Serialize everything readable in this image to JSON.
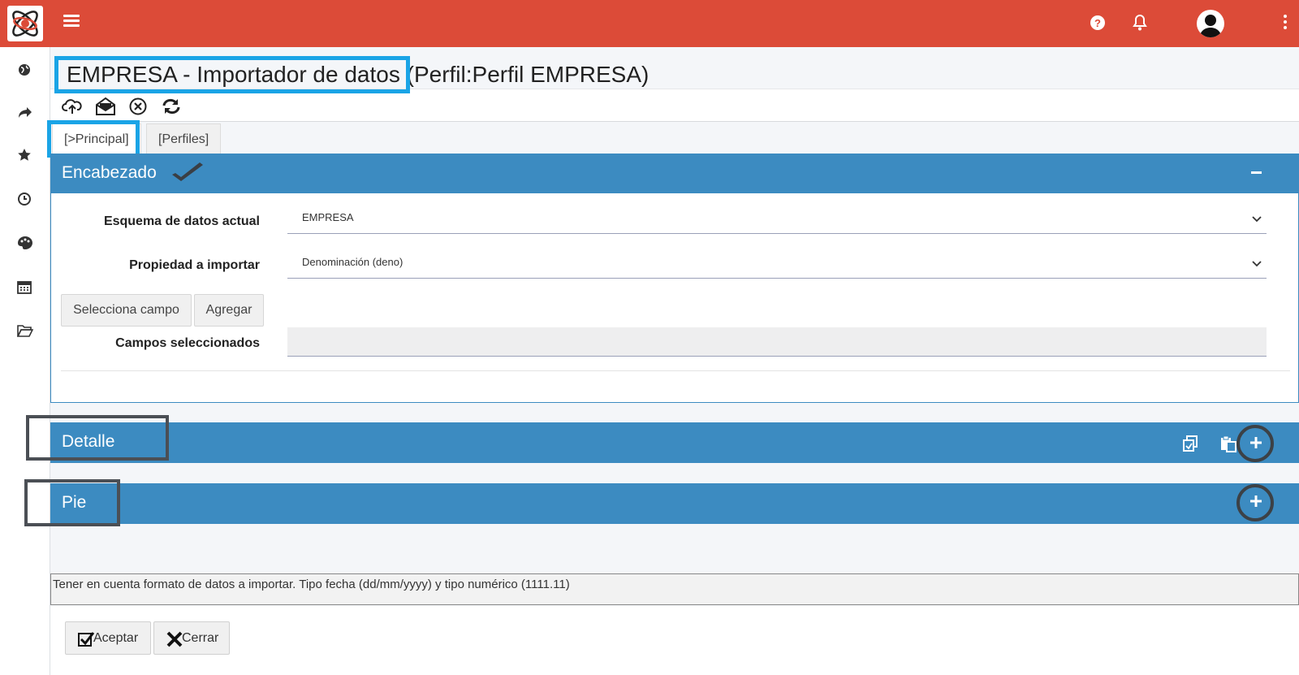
{
  "header": {
    "menu_icon": "hamburger-icon",
    "help_icon": "help-icon",
    "bell_icon": "bell-icon",
    "avatar_icon": "user-avatar-icon",
    "more_icon": "kebab-icon",
    "bar_color": "#dc4b38"
  },
  "sidebar": {
    "icons": [
      "globe-icon",
      "share-icon",
      "star-icon",
      "clock-icon",
      "palette-icon",
      "calendar-icon",
      "folder-icon"
    ]
  },
  "page": {
    "title": "EMPRESA - Importador de datos (Perfil:Perfil EMPRESA)"
  },
  "toolbar": {
    "icons": [
      "cloud-upload-icon",
      "envelope-open-icon",
      "cancel-circle-icon",
      "refresh-icon"
    ]
  },
  "tabs": [
    {
      "label": "[>Principal]",
      "active": true
    },
    {
      "label": "[Perfiles]",
      "active": false
    }
  ],
  "encabezado": {
    "title": "Encabezado",
    "fields": {
      "schema_label": "Esquema de datos actual",
      "schema_value": "EMPRESA",
      "property_label": "Propiedad a importar",
      "property_value": "Denominación (deno)",
      "select_field_button": "Selecciona campo",
      "add_button": "Agregar",
      "selected_fields_label": "Campos seleccionados",
      "selected_fields_value": ""
    }
  },
  "detalle": {
    "title": "Detalle"
  },
  "pie": {
    "title": "Pie"
  },
  "notice": "Tener en cuenta formato de datos a importar. Tipo fecha (dd/mm/yyyy) y tipo numérico (1111.11)",
  "footer": {
    "accept_label": "Aceptar",
    "close_label": "Cerrar"
  },
  "colors": {
    "panel": "#3c8bc1",
    "highlight_blue": "#1aa4e6"
  }
}
